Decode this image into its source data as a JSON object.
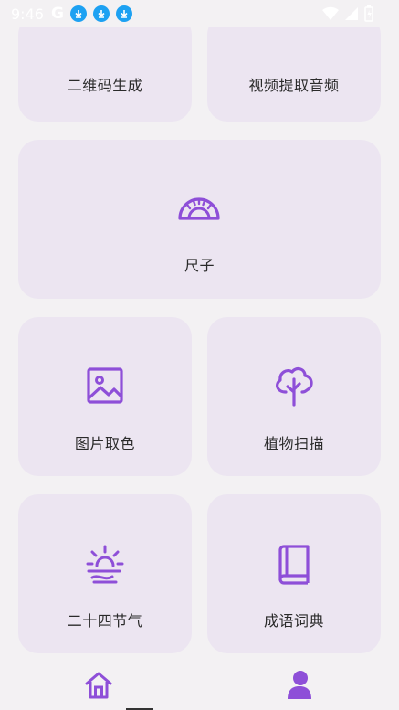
{
  "status": {
    "time": "9:46",
    "carrier_glyph": "G",
    "icons": [
      "download-icon",
      "download-icon",
      "download-icon",
      "wifi-icon",
      "signal-icon",
      "battery-icon"
    ]
  },
  "tools": [
    {
      "label": "二维码生成",
      "icon": "qrcode-icon"
    },
    {
      "label": "视频提取音频",
      "icon": "audio-extract-icon"
    },
    {
      "label": "尺子",
      "icon": "ruler-icon"
    },
    {
      "label": "图片取色",
      "icon": "image-icon"
    },
    {
      "label": "植物扫描",
      "icon": "tree-icon"
    },
    {
      "label": "二十四节气",
      "icon": "sunrise-icon"
    },
    {
      "label": "成语词典",
      "icon": "book-icon"
    }
  ],
  "nav": {
    "items": [
      {
        "name": "home",
        "icon": "home-icon"
      },
      {
        "name": "profile",
        "icon": "user-icon"
      }
    ]
  },
  "colors": {
    "accent": "#8e4fd8",
    "card": "#ece5f1",
    "background": "#f3f1f3"
  }
}
